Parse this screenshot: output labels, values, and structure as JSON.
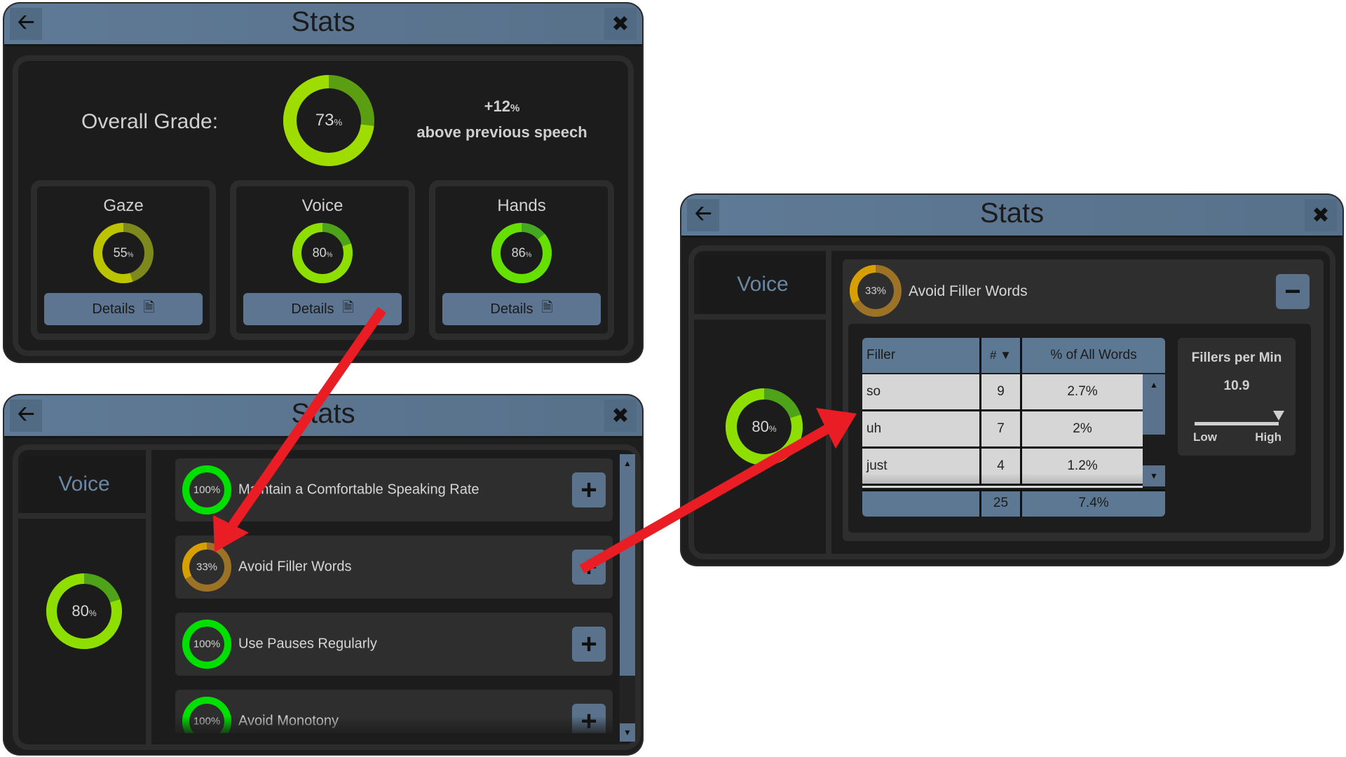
{
  "colors": {
    "titlebar": "#5d7893",
    "panel_bg": "#1c1c1c",
    "button": "#5d7590",
    "arrow": "#ea1c24",
    "ring_yellow": "#bcc400",
    "ring_lime": "#8ede00",
    "ring_green": "#00e000",
    "ring_orange": "#d7a000"
  },
  "overview": {
    "title": "Stats",
    "back_icon": "arrow-left-icon",
    "close_icon": "close-x-icon",
    "overall_label": "Overall Grade:",
    "overall": {
      "value": 73,
      "display": "73",
      "unit": "%"
    },
    "change": {
      "value": "+12",
      "unit": "%",
      "caption": "above previous speech"
    },
    "categories": [
      {
        "name": "Gaze",
        "value": 55,
        "display": "55",
        "unit": "%",
        "button": "Details",
        "icon": "document-search-icon"
      },
      {
        "name": "Voice",
        "value": 80,
        "display": "80",
        "unit": "%",
        "button": "Details",
        "icon": "document-search-icon"
      },
      {
        "name": "Hands",
        "value": 86,
        "display": "86",
        "unit": "%",
        "button": "Details",
        "icon": "document-search-icon"
      }
    ]
  },
  "voice_list": {
    "title": "Stats",
    "section": "Voice",
    "score": {
      "value": 80,
      "display": "80",
      "unit": "%"
    },
    "items": [
      {
        "label": "Maintain a Comfortable Speaking Rate",
        "value": 100,
        "display": "100%",
        "action": "+"
      },
      {
        "label": "Avoid Filler Words",
        "value": 33,
        "display": "33%",
        "action": "+"
      },
      {
        "label": "Use Pauses Regularly",
        "value": 100,
        "display": "100%",
        "action": "+"
      },
      {
        "label": "Avoid Monotony",
        "value": 100,
        "display": "100%",
        "action": "+"
      }
    ],
    "scroll_up": "▲",
    "scroll_down": "▼"
  },
  "filler_detail": {
    "title": "Stats",
    "section": "Voice",
    "score": {
      "value": 80,
      "display": "80",
      "unit": "%"
    },
    "item": {
      "label": "Avoid Filler Words",
      "value": 33,
      "display": "33%",
      "action": "−"
    },
    "table": {
      "headers": [
        "Filler",
        "# ▼",
        "% of All Words"
      ],
      "rows": [
        {
          "filler": "so",
          "count": "9",
          "pct": "2.7%"
        },
        {
          "filler": "uh",
          "count": "7",
          "pct": "2%"
        },
        {
          "filler": "just",
          "count": "4",
          "pct": "1.2%"
        }
      ],
      "totals": {
        "filler": "",
        "count": "25",
        "pct": "7.4%"
      },
      "scroll_up": "▲",
      "scroll_down": "▼"
    },
    "rate": {
      "title": "Fillers per Min",
      "value": "10.9",
      "low_label": "Low",
      "high_label": "High",
      "level_fraction": 1.0
    }
  }
}
